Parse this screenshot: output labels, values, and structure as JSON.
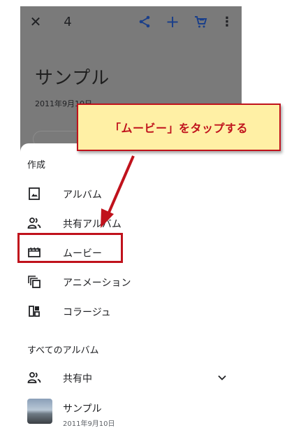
{
  "topbar": {
    "close_glyph": "✕",
    "selected_count": "4",
    "plus_glyph": "+",
    "more_glyph": "⋮",
    "icons": [
      "close-icon",
      "share-icon",
      "add-icon",
      "cart-icon",
      "more-vert-icon"
    ]
  },
  "album": {
    "title": "サンプル",
    "date": "2011年9月10日"
  },
  "sheet": {
    "create_header": "作成",
    "create_items": [
      {
        "label": "アルバム",
        "icon": "album-icon"
      },
      {
        "label": "共有アルバム",
        "icon": "shared-album-icon"
      },
      {
        "label": "ムービー",
        "icon": "movie-icon"
      },
      {
        "label": "アニメーション",
        "icon": "animation-icon"
      },
      {
        "label": "コラージュ",
        "icon": "collage-icon"
      }
    ],
    "albums_header": "すべてのアルバム",
    "shared_row": {
      "label": "共有中",
      "icon": "people-icon"
    },
    "album_row": {
      "label": "サンプル",
      "date": "2011年9月10日"
    }
  },
  "annotation": {
    "callout_text": "「ムービー」をタップする"
  },
  "colors": {
    "accent_blue": "#1a3f8a",
    "callout_bg": "#fff0a5",
    "annotation_red": "#c0121c",
    "dim_overlay": "#7a7a7a"
  }
}
